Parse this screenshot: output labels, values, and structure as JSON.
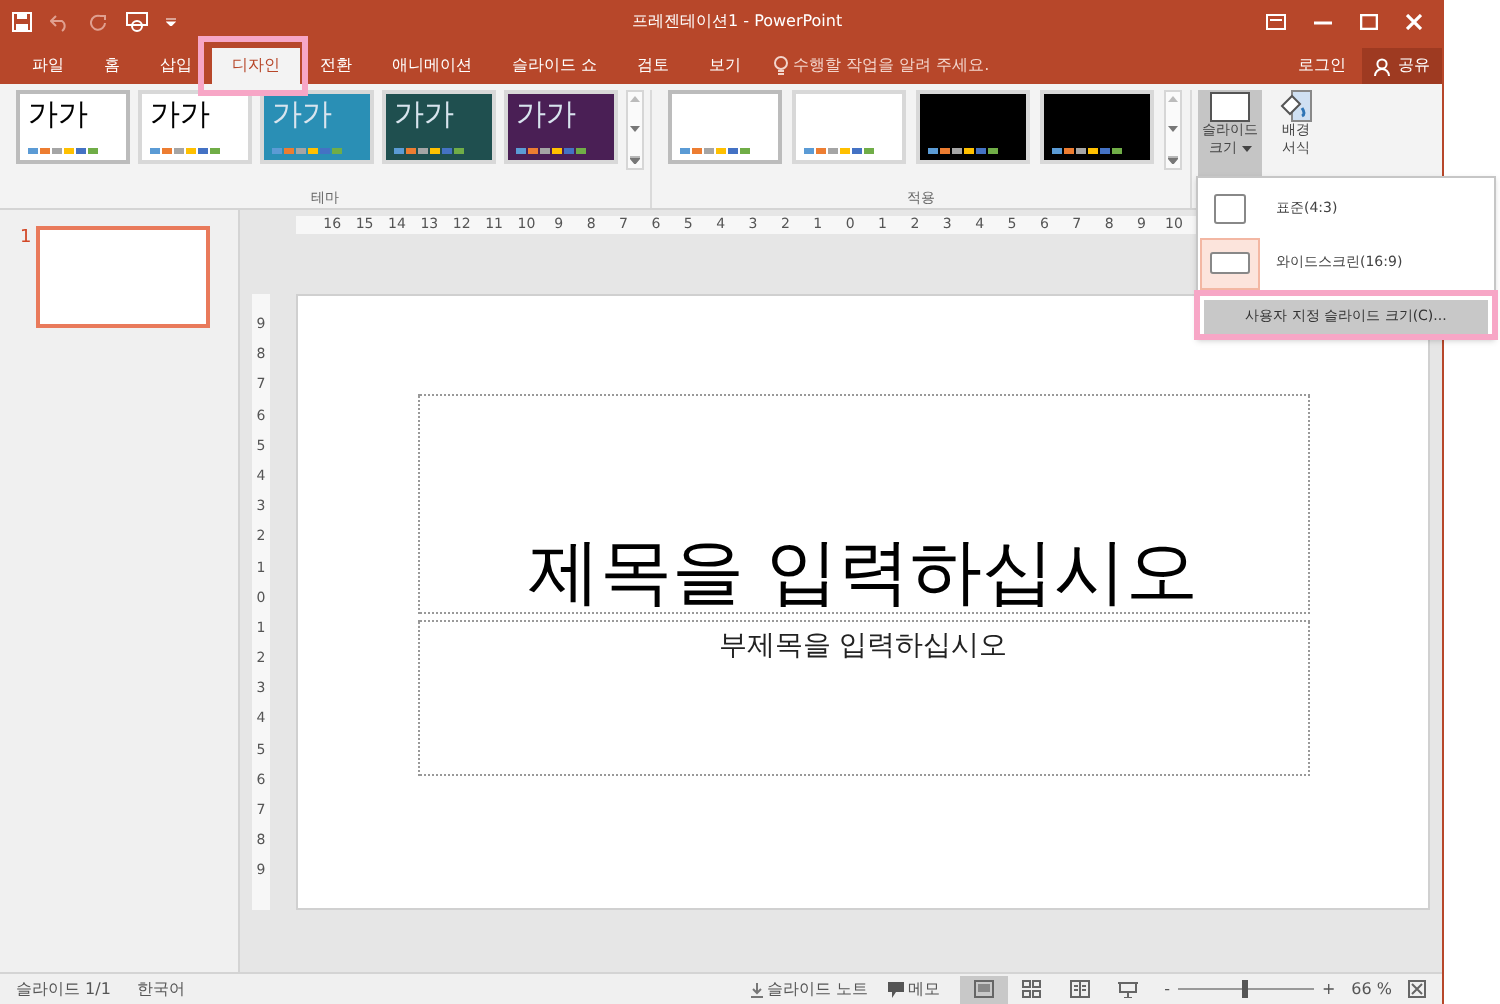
{
  "window": {
    "title": "프레젠테이션1 - PowerPoint"
  },
  "tabs": [
    {
      "label": "파일",
      "selected": false
    },
    {
      "label": "홈",
      "selected": false
    },
    {
      "label": "삽입",
      "selected": false
    },
    {
      "label": "디자인",
      "selected": true
    },
    {
      "label": "전환",
      "selected": false
    },
    {
      "label": "애니메이션",
      "selected": false
    },
    {
      "label": "슬라이드 쇼",
      "selected": false
    },
    {
      "label": "검토",
      "selected": false
    },
    {
      "label": "보기",
      "selected": false
    }
  ],
  "tell_me": {
    "placeholder": "수행할 작업을 알려 주세요."
  },
  "account": {
    "sign_in": "로그인",
    "share": "공유"
  },
  "themes": {
    "label": "테마",
    "items": [
      {
        "text": "가가",
        "color": "#ffffff",
        "selected": true
      },
      {
        "text": "가가",
        "color": "#ffffff",
        "selected": false
      },
      {
        "text": "가가",
        "color": "#2a8fb5",
        "selected": false
      },
      {
        "text": "가가",
        "color": "#1f4f4f",
        "selected": false
      },
      {
        "text": "가가",
        "color": "#4a1f55",
        "selected": false
      }
    ]
  },
  "variants": {
    "label": "적용",
    "items": [
      {
        "color": "#ffffff",
        "selected": true
      },
      {
        "color": "#ffffff",
        "selected": false
      },
      {
        "color": "#000000",
        "selected": false
      },
      {
        "color": "#000000",
        "selected": false
      }
    ]
  },
  "slide_size_button": {
    "lines": [
      "슬라이드",
      "크기"
    ],
    "expanded": true
  },
  "format_background_button": {
    "lines": [
      "배경",
      "서식"
    ]
  },
  "slide_size_menu": [
    {
      "kind": "option",
      "label": "표준(4:3)",
      "selected": false
    },
    {
      "kind": "option",
      "label": "와이드스크린(16:9)",
      "selected": true
    },
    {
      "kind": "command",
      "label": "사용자 지정 슬라이드 크기(C)...",
      "highlighted": true
    }
  ],
  "thumbnails": [
    {
      "number": "1",
      "selected": true
    }
  ],
  "horizontal_ruler": [
    "16",
    "15",
    "14",
    "13",
    "12",
    "11",
    "10",
    "9",
    "8",
    "7",
    "6",
    "5",
    "4",
    "3",
    "2",
    "1",
    "0",
    "1",
    "2",
    "3",
    "4",
    "5",
    "6",
    "7",
    "8",
    "9",
    "10"
  ],
  "vertical_ruler": [
    "9",
    "8",
    "7",
    "6",
    "5",
    "4",
    "3",
    "2",
    "1",
    "0",
    "1",
    "2",
    "3",
    "4",
    "5",
    "6",
    "7",
    "8",
    "9"
  ],
  "slide": {
    "title": "제목을 입력하십시오",
    "subtitle": "부제목을 입력하십시오"
  },
  "status_bar": {
    "slide": "슬라이드 1/1",
    "language": "한국어",
    "notes": "슬라이드 노트",
    "comments": "메모",
    "views": [
      {
        "kind": "normal",
        "selected": true
      },
      {
        "kind": "sorter",
        "selected": false
      },
      {
        "kind": "reading",
        "selected": false
      },
      {
        "kind": "show",
        "selected": false
      }
    ],
    "zoom": {
      "minus": "-",
      "plus": "+",
      "level": 0.5,
      "reading": "66 %"
    }
  }
}
